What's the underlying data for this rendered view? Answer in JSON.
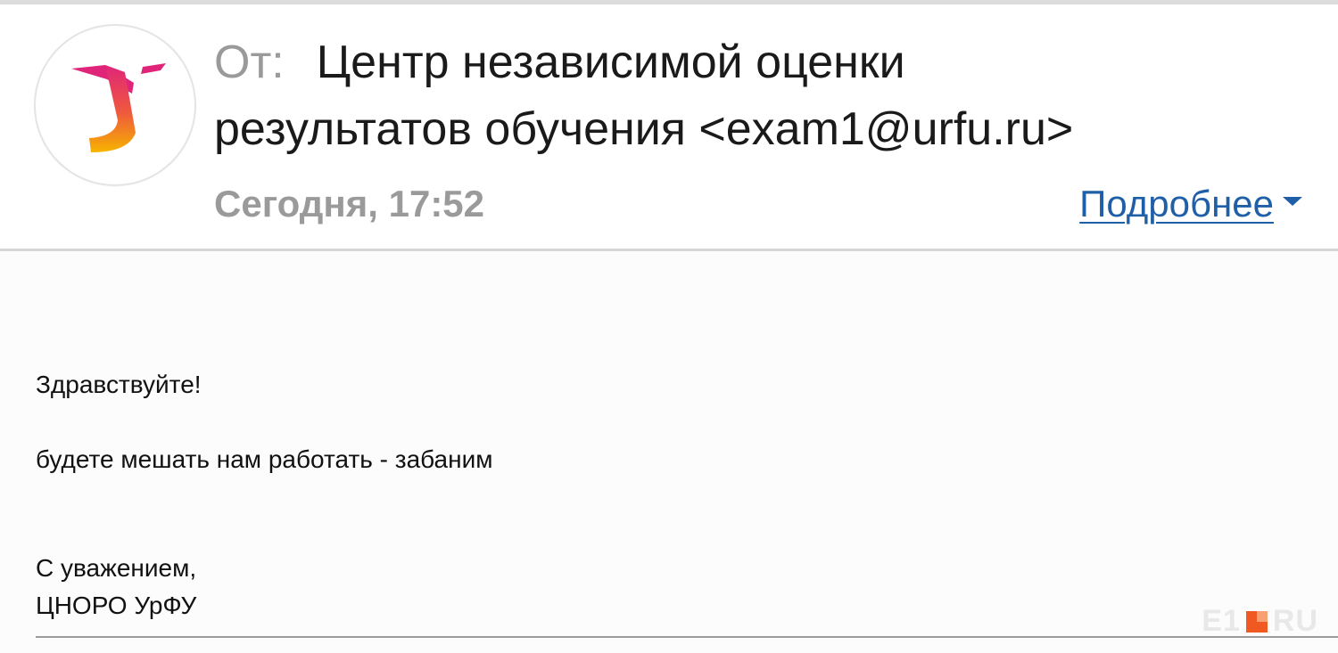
{
  "header": {
    "from_label": "От:",
    "sender_line1": "Центр независимой оценки",
    "sender_line2": "результатов обучения <exam1@urfu.ru>",
    "date": "Сегодня, 17:52",
    "details_label": "Подробнее",
    "avatar_icon": "urfu-logo-icon"
  },
  "message": {
    "greeting": "Здравствуйте!",
    "body": "будете мешать нам работать - забаним",
    "signoff": "С уважением,",
    "signature": "ЦНОРО УрФУ"
  },
  "watermark": {
    "left": "E1",
    "right": "RU"
  },
  "colors": {
    "link": "#1f5fa8",
    "muted": "#9a9a9a",
    "logo_top": "#e0247a",
    "logo_bottom": "#f6b400"
  }
}
